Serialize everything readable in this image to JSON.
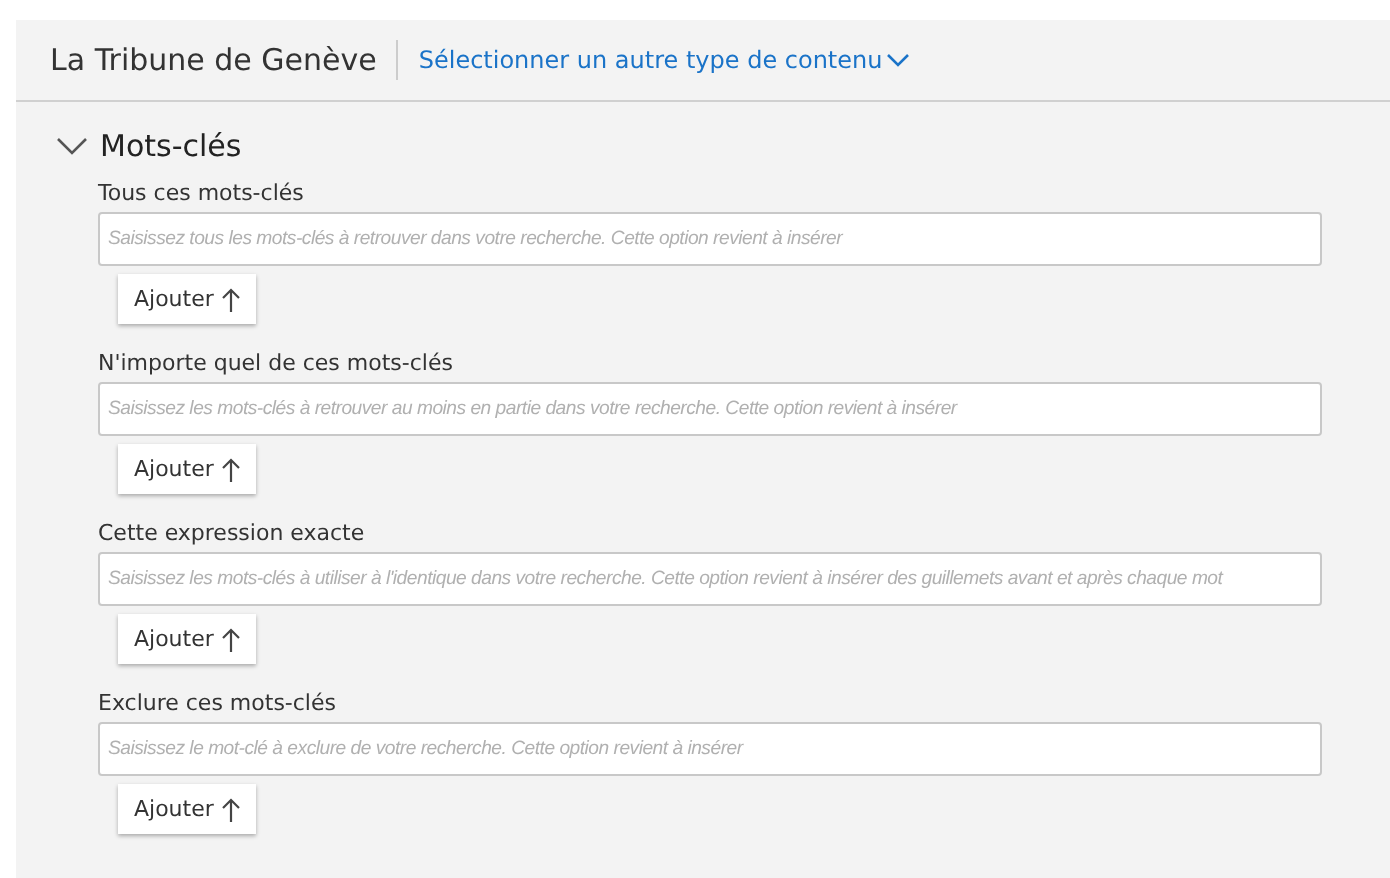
{
  "header": {
    "title": "La Tribune de Genève",
    "content_type_link": "Sélectionner un autre type de contenu"
  },
  "section": {
    "title": "Mots-clés",
    "expanded": true,
    "fields": [
      {
        "label": "Tous ces mots-clés",
        "placeholder": "Saisissez tous les mots-clés à retrouver dans votre recherche. Cette option revient à insérer",
        "button": "Ajouter"
      },
      {
        "label": "N'importe quel de ces mots-clés",
        "placeholder": "Saisissez les mots-clés à retrouver au moins en partie dans votre recherche. Cette option revient à insérer",
        "button": "Ajouter"
      },
      {
        "label": "Cette expression exacte",
        "placeholder": "Saisissez les mots-clés à utiliser à l'identique dans votre recherche. Cette option revient à insérer des guillemets avant et après chaque mot",
        "button": "Ajouter"
      },
      {
        "label": "Exclure ces mots-clés",
        "placeholder": "Saisissez le mot-clé à exclure de votre recherche. Cette option revient à insérer",
        "button": "Ajouter"
      }
    ]
  }
}
